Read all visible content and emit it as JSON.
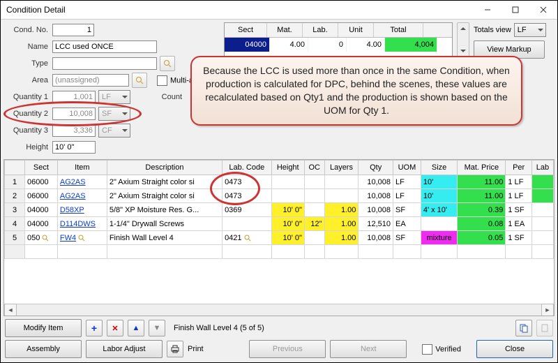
{
  "window": {
    "title": "Condition Detail"
  },
  "form": {
    "cond_no_label": "Cond. No.",
    "cond_no": "1",
    "name_label": "Name",
    "name": "LCC used ONCE",
    "type_label": "Type",
    "type": "",
    "area_label": "Area",
    "area": "(unassigned)",
    "multi_label": "Multi-ar",
    "q1_label": "Quantity 1",
    "q1": "1,001",
    "q1_uom": "LF",
    "count_label": "Count",
    "q2_label": "Quantity 2",
    "q2": "10,008",
    "q2_uom": "SF",
    "q3_label": "Quantity 3",
    "q3": "3,336",
    "q3_uom": "CF",
    "height_label": "Height",
    "height": "10' 0\""
  },
  "mini": {
    "h": [
      "Sect",
      "Mat.",
      "Lab.",
      "Unit",
      "Total"
    ],
    "r": [
      "04000",
      "4.00",
      "0",
      "4.00",
      "4,004"
    ]
  },
  "totals": {
    "label": "Totals view",
    "uom": "LF",
    "view_markup": "View Markup"
  },
  "callout": "Because the LCC is used more than once in the same Condition, when production is calculated for DPC, behind the scenes, these values are recalculated based on Qty1 and the production is shown based on the UOM for Qty 1.",
  "cols": [
    "",
    "Sect",
    "Item",
    "Description",
    "Lab. Code",
    "Height",
    "OC",
    "Layers",
    "Qty",
    "UOM",
    "Size",
    "Mat. Price",
    "Per",
    "Lab"
  ],
  "rows": [
    {
      "n": "1",
      "sect": "06000",
      "item": "AG2AS",
      "desc": "2\" Axium Straight color si",
      "lab": "0473",
      "h": "",
      "oc": "",
      "lay": "",
      "qty": "10,008",
      "uom": "LF",
      "size": "10'",
      "size_bg": "cyan",
      "mat": "11.00",
      "per": "1 LF",
      "lab_bg": "green"
    },
    {
      "n": "2",
      "sect": "06000",
      "item": "AG2AS",
      "desc": "2\" Axium Straight color si",
      "lab": "0473",
      "h": "",
      "oc": "",
      "lay": "",
      "qty": "10,008",
      "uom": "LF",
      "size": "10'",
      "size_bg": "cyan",
      "mat": "11.00",
      "per": "1 LF",
      "lab_bg": "green"
    },
    {
      "n": "3",
      "sect": "04000",
      "item": "D58XP",
      "desc": "5/8\" XP Moisture Res. G...",
      "lab": "0369",
      "h": "10' 0\"",
      "oc": "",
      "lay": "1.00",
      "qty": "10,008",
      "uom": "SF",
      "size": "4' x 10'",
      "size_bg": "cyan",
      "mat": "0.39",
      "per": "1 SF",
      "lab_bg": ""
    },
    {
      "n": "4",
      "sect": "04000",
      "item": "D114DWS",
      "desc": "1-1/4\" Drywall Screws",
      "lab": "",
      "h": "10' 0\"",
      "oc": "12\"",
      "lay": "1.00",
      "qty": "12,510",
      "uom": "EA",
      "size": "",
      "size_bg": "",
      "mat": "0.08",
      "per": "1 EA",
      "lab_bg": ""
    },
    {
      "n": "5",
      "sect": "050",
      "item": "FW4",
      "desc": "Finish Wall Level 4",
      "lab": "0421",
      "h": "10' 0\"",
      "oc": "",
      "lay": "1.00",
      "qty": "10,008",
      "uom": "SF",
      "size": "mixture",
      "size_bg": "magenta",
      "mat": "0.05",
      "per": "1 SF",
      "lab_bg": ""
    }
  ],
  "footer": {
    "modify": "Modify Item",
    "status": "Finish Wall Level 4 (5 of 5)",
    "assembly": "Assembly",
    "labor_adjust": "Labor Adjust",
    "print": "Print",
    "previous": "Previous",
    "next": "Next",
    "verified": "Verified",
    "close": "Close"
  }
}
